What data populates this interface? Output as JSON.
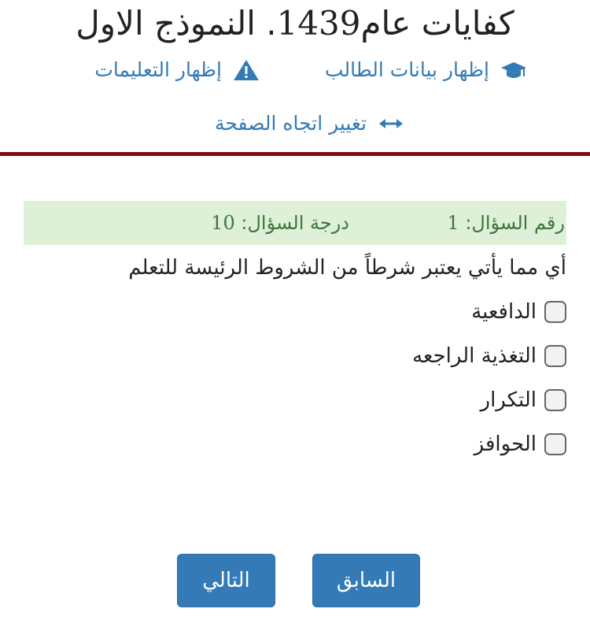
{
  "header": {
    "title_prefix": "كفايات عام",
    "title_year": "1439",
    "title_suffix": ". النموذج الاول"
  },
  "links": {
    "student_data": {
      "label": "إظهار بيانات الطالب",
      "icon": "graduation-cap-icon"
    },
    "instructions": {
      "label": "إظهار التعليمات",
      "icon": "warning-icon"
    },
    "page_direction": {
      "label": "تغيير اتجاه الصفحة",
      "icon": "arrows-horizontal-icon"
    }
  },
  "question_info": {
    "number_label": "رقم السؤال:",
    "number_value": "1",
    "score_label": "درجة السؤال:",
    "score_value": "10"
  },
  "question": {
    "text": "أي مما يأتي يعتبر شرطاً من الشروط الرئيسة للتعلم",
    "options": [
      {
        "label": "الدافعية",
        "checked": false
      },
      {
        "label": "التغذية الراجعه",
        "checked": false
      },
      {
        "label": "التكرار",
        "checked": false
      },
      {
        "label": "الحوافز",
        "checked": false
      }
    ]
  },
  "navigation": {
    "previous_label": "السابق",
    "next_label": "التالي"
  },
  "colors": {
    "link": "#337ab7",
    "divider": "#7b0f0f",
    "info_bg": "#dff0d8",
    "info_text": "#3c763d",
    "button": "#337ab7"
  }
}
